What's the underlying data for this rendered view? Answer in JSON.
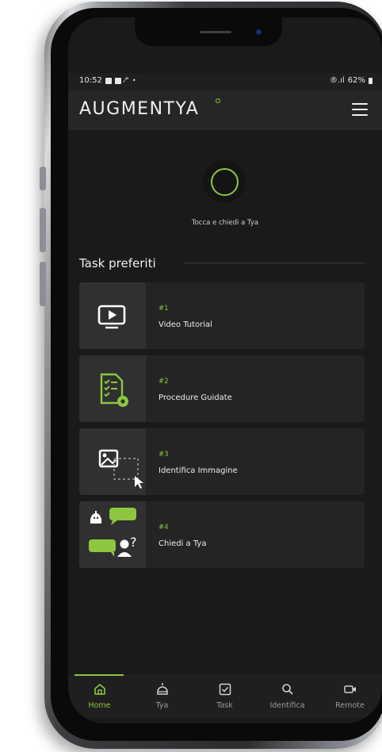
{
  "status_bar": {
    "time": "10:52",
    "signal_text": "®.ıl",
    "battery": "62%"
  },
  "header": {
    "logo": "AUGMENTYA"
  },
  "assistant": {
    "caption": "Tocca e chiedi a Tya"
  },
  "favorites": {
    "title": "Task preferiti",
    "items": [
      {
        "number": "#1",
        "title": "Video Tutorial",
        "icon": "video-player-icon"
      },
      {
        "number": "#2",
        "title": "Procedure Guidate",
        "icon": "checklist-gear-icon"
      },
      {
        "number": "#3",
        "title": "Identifica Immagine",
        "icon": "image-select-icon"
      },
      {
        "number": "#4",
        "title": "Chiedi a Tya",
        "icon": "chat-bot-icon"
      }
    ]
  },
  "bottom_nav": {
    "items": [
      {
        "label": "Home",
        "icon": "home-icon",
        "active": true
      },
      {
        "label": "Tya",
        "icon": "robot-icon",
        "active": false
      },
      {
        "label": "Task",
        "icon": "checkbox-icon",
        "active": false
      },
      {
        "label": "Identifica",
        "icon": "search-icon",
        "active": false
      },
      {
        "label": "Remote",
        "icon": "video-camera-icon",
        "active": false
      }
    ]
  },
  "colors": {
    "accent": "#8dc63f",
    "background": "#1a1a1a",
    "card": "#242424",
    "header": "#262626"
  }
}
